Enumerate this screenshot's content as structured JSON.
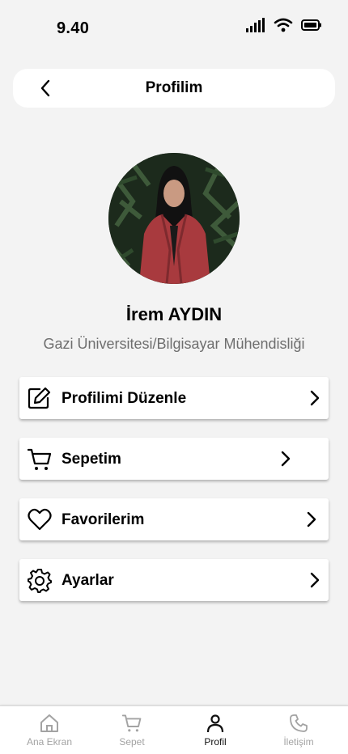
{
  "status_bar": {
    "time": "9.40"
  },
  "header": {
    "title": "Profilim"
  },
  "profile": {
    "name": "İrem AYDIN",
    "subtitle": "Gazi Üniversitesi/Bilgisayar Mühendisliği"
  },
  "menu": [
    {
      "label": "Profilimi Düzenle",
      "icon": "edit-icon"
    },
    {
      "label": "Sepetim",
      "icon": "cart-icon"
    },
    {
      "label": "Favorilerim",
      "icon": "heart-icon"
    },
    {
      "label": "Ayarlar",
      "icon": "gear-icon"
    }
  ],
  "bottom_nav": [
    {
      "label": "Ana Ekran",
      "icon": "home-icon",
      "active": false
    },
    {
      "label": "Sepet",
      "icon": "cart-icon",
      "active": false
    },
    {
      "label": "Profil",
      "icon": "person-icon",
      "active": true
    },
    {
      "label": "İletişim",
      "icon": "phone-icon",
      "active": false
    }
  ],
  "colors": {
    "background": "#f3f3f3",
    "card": "#ffffff",
    "subtitle_text": "#6e6e6e",
    "inactive_nav": "#a3a3a3",
    "active_nav": "#111111"
  }
}
